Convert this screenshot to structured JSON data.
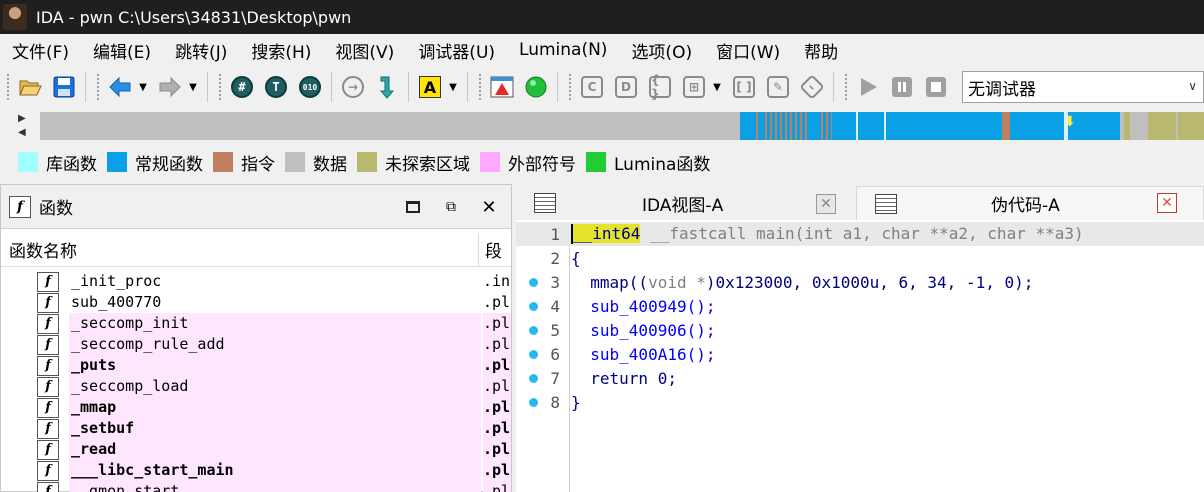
{
  "window": {
    "title": "IDA - pwn C:\\Users\\34831\\Desktop\\pwn"
  },
  "menu": [
    "文件(F)",
    "编辑(E)",
    "跳转(J)",
    "搜索(H)",
    "视图(V)",
    "调试器(U)",
    "Lumina(N)",
    "选项(O)",
    "窗口(W)",
    "帮助"
  ],
  "toolbar": {
    "debugger_value": "无调试器",
    "text_button_label": "A"
  },
  "legend": [
    {
      "label": "库函数",
      "color": "#a0ffff"
    },
    {
      "label": "常规函数",
      "color": "#0aa0e6"
    },
    {
      "label": "指令",
      "color": "#c08060"
    },
    {
      "label": "数据",
      "color": "#c0c0c0"
    },
    {
      "label": "未探索区域",
      "color": "#b8b870"
    },
    {
      "label": "外部符号",
      "color": "#ffa8ff"
    },
    {
      "label": "Lumina函数",
      "color": "#22cc33"
    }
  ],
  "functions_panel": {
    "title": "函数",
    "col_name": "函数名称",
    "col_segment": "段",
    "rows": [
      {
        "name": "_init_proc",
        "seg": ".init",
        "pink": false,
        "bold": false
      },
      {
        "name": "sub_400770",
        "seg": ".plt",
        "pink": false,
        "bold": false
      },
      {
        "name": "_seccomp_init",
        "seg": ".plt",
        "pink": true,
        "bold": false
      },
      {
        "name": "_seccomp_rule_add",
        "seg": ".plt",
        "pink": true,
        "bold": false
      },
      {
        "name": "_puts",
        "seg": ".plt",
        "pink": true,
        "bold": true
      },
      {
        "name": "_seccomp_load",
        "seg": ".plt",
        "pink": true,
        "bold": false
      },
      {
        "name": "_mmap",
        "seg": ".plt",
        "pink": true,
        "bold": true
      },
      {
        "name": "_setbuf",
        "seg": ".plt",
        "pink": true,
        "bold": true
      },
      {
        "name": "_read",
        "seg": ".plt",
        "pink": true,
        "bold": true
      },
      {
        "name": "___libc_start_main",
        "seg": ".plt",
        "pink": true,
        "bold": true
      },
      {
        "name": "__gmon_start__",
        "seg": ".plt",
        "pink": true,
        "bold": false
      }
    ]
  },
  "tabs": [
    {
      "label": "IDA视图-A"
    },
    {
      "label": "伪代码-A"
    }
  ],
  "code": {
    "line_numbers": [
      "1",
      "2",
      "3",
      "4",
      "5",
      "6",
      "7",
      "8"
    ],
    "l1": {
      "hl": "__int64",
      "cc": "__fastcall",
      "fn": "main(",
      "t1": "int",
      "a1": "a1,",
      "t2": "char",
      "a2": "**a2,",
      "t3": "char",
      "a3": "**a3)"
    },
    "l2": "{",
    "l3": {
      "pre": "mmap((",
      "cast": "void *",
      "post": ")0x123000, 0x1000u, 6, 34, -1, 0);"
    },
    "l4": "sub_400949();",
    "l5": "sub_400906();",
    "l6": "sub_400A16();",
    "l7": "return 0;",
    "l8": "}"
  }
}
